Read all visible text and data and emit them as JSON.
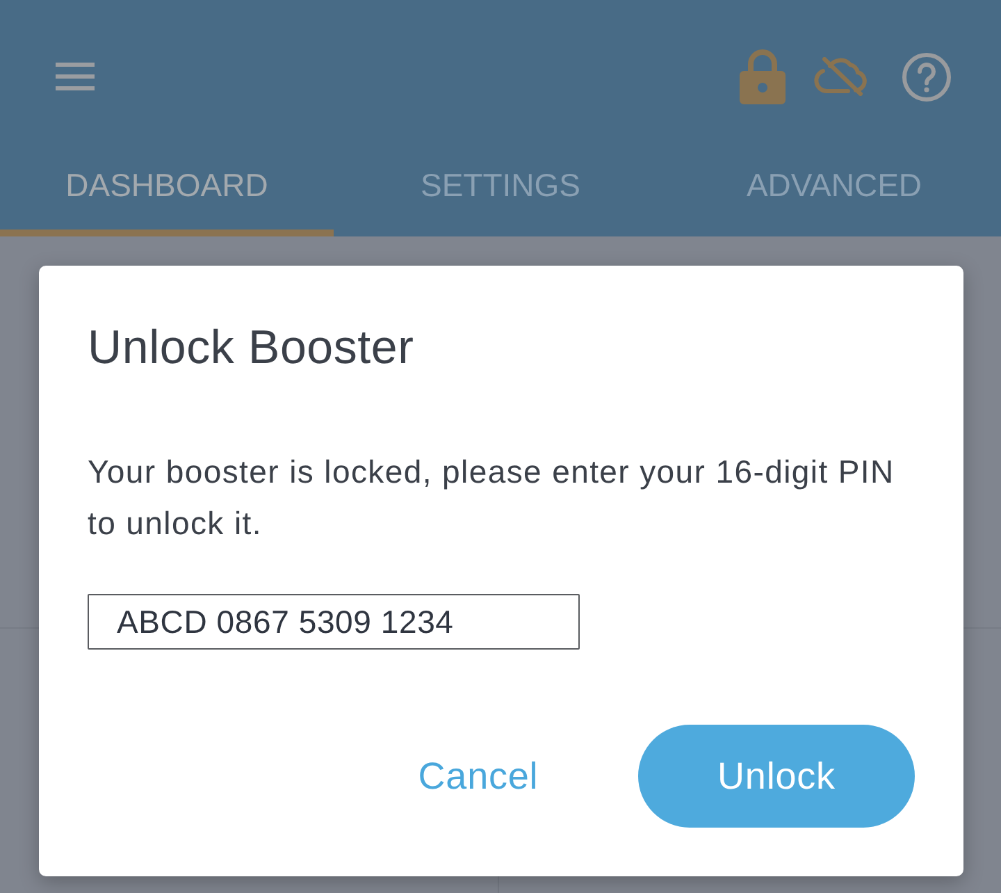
{
  "tabs": [
    {
      "label": "DASHBOARD",
      "selected": true
    },
    {
      "label": "SETTINGS",
      "selected": false
    },
    {
      "label": "ADVANCED",
      "selected": false
    }
  ],
  "dialog": {
    "title": "Unlock Booster",
    "message": "Your booster is locked, please enter your 16-digit PIN to unlock it.",
    "pin_field": {
      "value": "ABCD 0867 5309 1234"
    },
    "buttons": [
      {
        "label": "Cancel",
        "kind": "text"
      },
      {
        "label": "Unlock",
        "kind": "filled"
      }
    ]
  }
}
